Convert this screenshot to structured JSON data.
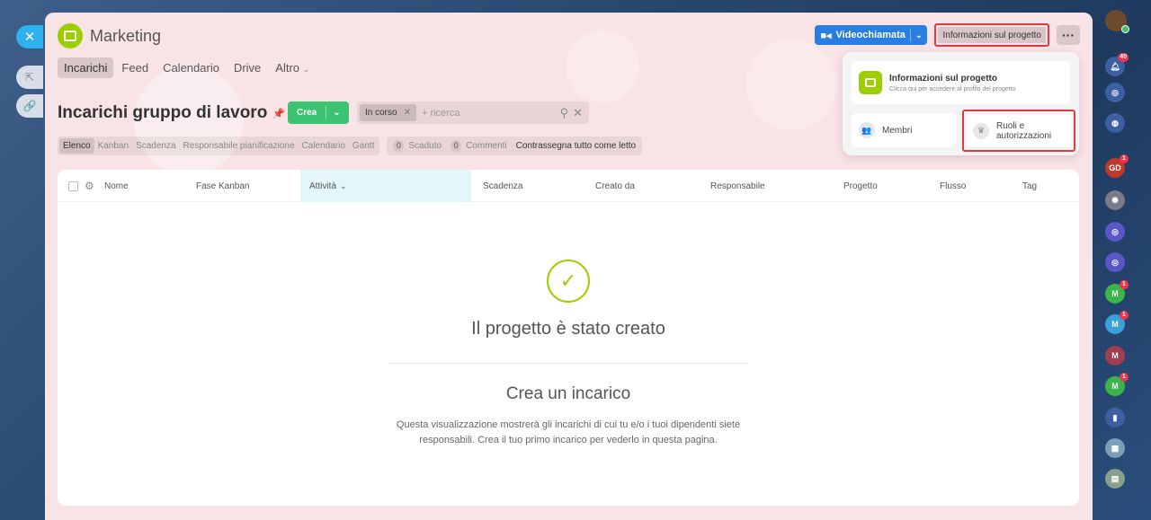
{
  "project": {
    "name": "Marketing"
  },
  "nav": {
    "items": [
      "Incarichi",
      "Feed",
      "Calendario",
      "Drive",
      "Altro"
    ],
    "active": "Incarichi",
    "more_chevron": "⌄"
  },
  "header": {
    "video_call": "Videochiamata",
    "project_info": "Informazioni sul progetto",
    "more": "···"
  },
  "popup": {
    "info_title": "Informazioni sul progetto",
    "info_subtitle": "Clicca qui per accedere al profilo del progetto",
    "members": "Membri",
    "roles": "Ruoli e autorizzazioni"
  },
  "page": {
    "title": "Incarichi gruppo di lavoro",
    "create_button": "Crea"
  },
  "search": {
    "chip": "In corso",
    "placeholder": "+ ricerca"
  },
  "views": {
    "tabs": [
      "Elenco",
      "Kanban",
      "Scadenza",
      "Responsabile pianificazione",
      "Calendario",
      "Gantt"
    ],
    "active": "Elenco",
    "overdue_count": "0",
    "overdue_label": "Scaduto",
    "comments_count": "0",
    "comments_label": "Commenti",
    "mark_all_read": "Contrassegna tutto come letto"
  },
  "grid": {
    "columns": [
      "Nome",
      "Fase Kanban",
      "Attività",
      "Scadenza",
      "Creato da",
      "Responsabile",
      "Progetto",
      "Flusso",
      "Tag"
    ],
    "sorted_column": "Attività"
  },
  "empty_state": {
    "title": "Il progetto è stato creato",
    "create_title": "Crea un incarico",
    "description": "Questa visualizzazione mostrerà gli incarichi di cui tu e/o i tuoi dipendenti siete responsabili. Crea il tuo primo incarico per vederlo in questa pagina."
  },
  "right_rail": {
    "notifications_badge": "40",
    "avatars": [
      {
        "initials": "GD",
        "badge": "1",
        "color": "#c0392b"
      },
      {
        "initials": "M",
        "badge": "1",
        "color": "#3bb54a"
      },
      {
        "initials": "M",
        "badge": "1",
        "color": "#3aa1d8"
      },
      {
        "initials": "M",
        "badge": "",
        "color": "#a33d4f"
      },
      {
        "initials": "M",
        "badge": "1",
        "color": "#3bb54a"
      }
    ]
  },
  "colors": {
    "accent_green": "#3bc371",
    "brand_lime": "#9dcf00",
    "video_blue": "#2a7de1",
    "highlight_red": "#e0393e"
  }
}
